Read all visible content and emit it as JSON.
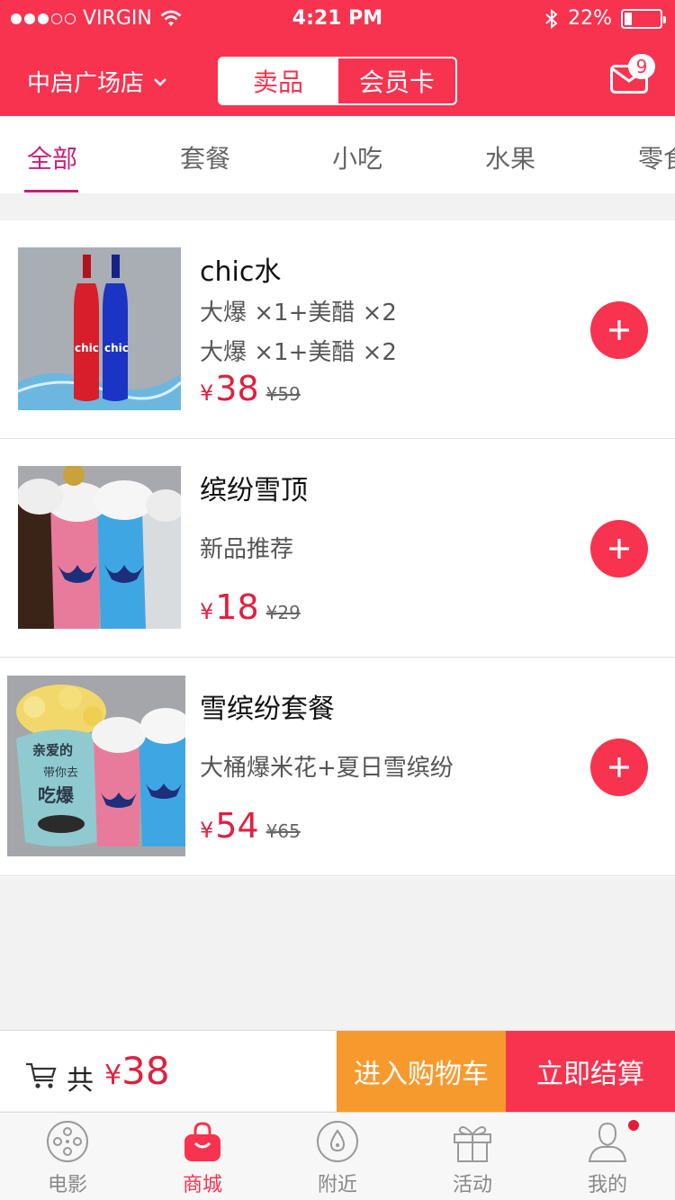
{
  "status_bar": {
    "carrier": "VIRGIN",
    "time": "4:21 PM",
    "battery": "22%",
    "battery_level": 0.22,
    "signal_dots_filled": 3,
    "signal_dots_total": 5
  },
  "header": {
    "store_name": "中启广场店",
    "segment_active": "卖品",
    "segment_inactive": "会员卡",
    "mail_badge": "9",
    "accent_color": "#f7334f"
  },
  "categories": {
    "items": [
      "全部",
      "套餐",
      "小吃",
      "水果",
      "零食"
    ],
    "active_index": 0
  },
  "products": [
    {
      "name": "chic水",
      "desc_lines": [
        "大爆 ×1+美醋 ×2",
        "大爆 ×1+美醋 ×2"
      ],
      "currency": "¥",
      "price": "38",
      "original_price": "¥59",
      "image_label": "chic"
    },
    {
      "name": "缤纷雪顶",
      "desc_lines": [
        "新品推荐"
      ],
      "currency": "¥",
      "price": "18",
      "original_price": "¥29"
    },
    {
      "name": "雪缤纷套餐",
      "desc_lines": [
        "大桶爆米花+夏日雪缤纷"
      ],
      "currency": "¥",
      "price": "54",
      "original_price": "¥65",
      "image_label_1": "亲爱的",
      "image_label_2": "带你去",
      "image_label_3": "吃爆"
    }
  ],
  "cart": {
    "total_label": "共",
    "currency": "¥",
    "total": "38",
    "to_cart_label": "进入购物车",
    "checkout_label": "立即结算",
    "cart_button_color": "#f79a2e"
  },
  "tabbar": {
    "items": [
      {
        "label": "电影",
        "icon": "film-reel-icon"
      },
      {
        "label": "商城",
        "icon": "shopping-bag-icon"
      },
      {
        "label": "附近",
        "icon": "location-drop-icon"
      },
      {
        "label": "活动",
        "icon": "gift-icon"
      },
      {
        "label": "我的",
        "icon": "user-icon"
      }
    ],
    "active_index": 1
  }
}
